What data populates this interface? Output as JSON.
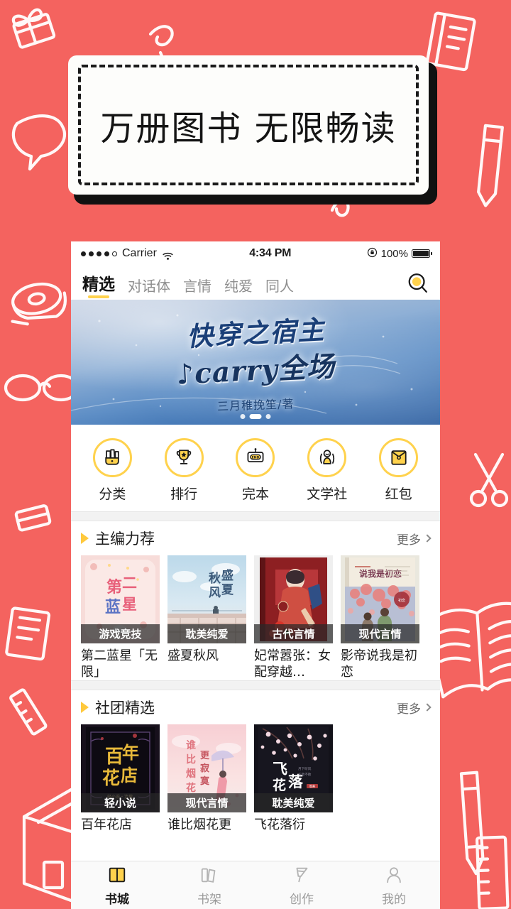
{
  "theme": {
    "background": "#F4635F",
    "accent_yellow": "#FFD24D",
    "text_dark": "#1c1c1c"
  },
  "promo": {
    "headline": "万册图书  无限畅读"
  },
  "status_bar": {
    "carrier": "Carrier",
    "time": "4:34 PM",
    "battery_percent": "100%",
    "signal_dots_filled": 4,
    "signal_dots_total": 5,
    "wifi_icon": "wifi-icon",
    "lock_icon": "rotation-lock-icon",
    "battery_icon": "battery-full-icon"
  },
  "nav": {
    "tabs": [
      {
        "label": "精选",
        "active": true
      },
      {
        "label": "对话体",
        "active": false
      },
      {
        "label": "言情",
        "active": false
      },
      {
        "label": "纯爱",
        "active": false
      },
      {
        "label": "同人",
        "active": false
      }
    ],
    "search_icon": "search-icon"
  },
  "banner": {
    "title_line1": "快穿之宿主",
    "title_line2": "♪carry全场",
    "author": "三月稚挽笙/著",
    "dots_total": 3,
    "dots_active_index": 1
  },
  "quick_actions": [
    {
      "label": "分类",
      "icon": "category-bag-icon"
    },
    {
      "label": "排行",
      "icon": "trophy-icon"
    },
    {
      "label": "完本",
      "icon": "end-sign-icon"
    },
    {
      "label": "文学社",
      "icon": "literary-club-icon"
    },
    {
      "label": "红包",
      "icon": "red-envelope-icon"
    }
  ],
  "sections": [
    {
      "title": "主编力荐",
      "more_label": "更多",
      "books": [
        {
          "name": "第二蓝星「无限」",
          "tag": "游戏竞技",
          "cover_style": "cover-pink-second-blue"
        },
        {
          "name": "盛夏秋风",
          "tag": "耽美纯爱",
          "cover_style": "cover-sky-summer"
        },
        {
          "name": "妃常嚣张：女配穿越…",
          "tag": "古代言情",
          "cover_style": "cover-red-ancient"
        },
        {
          "name": "影帝说我是初恋",
          "tag": "现代言情",
          "cover_style": "cover-cream-modern"
        }
      ]
    },
    {
      "title": "社团精选",
      "more_label": "更多",
      "books": [
        {
          "name": "百年花店",
          "tag": "轻小说",
          "cover_style": "cover-black-gold-flower"
        },
        {
          "name": "谁比烟花更",
          "tag": "现代言情",
          "cover_style": "cover-pink-firework"
        },
        {
          "name": "飞花落衍",
          "tag": "耽美纯爱",
          "cover_style": "cover-dark-blossom"
        }
      ]
    }
  ],
  "bottom_tabs": [
    {
      "label": "书城",
      "icon": "book-store-icon",
      "active": true
    },
    {
      "label": "书架",
      "icon": "bookshelf-icon",
      "active": false
    },
    {
      "label": "创作",
      "icon": "quill-create-icon",
      "active": false
    },
    {
      "label": "我的",
      "icon": "person-profile-icon",
      "active": false
    }
  ]
}
